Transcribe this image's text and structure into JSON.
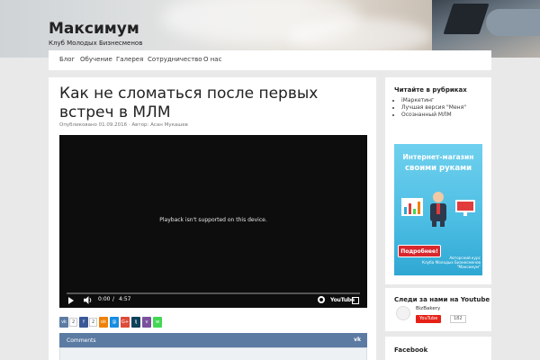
{
  "site": {
    "title": "Максимум",
    "description": "Клуб Молодых Бизнесменов"
  },
  "nav": {
    "items": [
      "Блог",
      "Обучение",
      "Галерея",
      "Сотрудничество",
      "О нас"
    ]
  },
  "post": {
    "title": "Как не сломаться после первых встреч в МЛМ",
    "meta": "Опубликовано 01.09.2016 · Автор: Асан Мукашев"
  },
  "video": {
    "message": "Playback isn't supported on this device.",
    "time_current": "0:00",
    "time_separator": "/",
    "time_total": "4:57",
    "logo": "YouTube"
  },
  "share": {
    "buttons": [
      {
        "icon": "vk-icon",
        "label": "vk",
        "count": "2",
        "color": "#5b7ba3"
      },
      {
        "icon": "facebook-icon",
        "label": "f",
        "count": "2",
        "color": "#3b5998"
      },
      {
        "icon": "odnoklassniki-icon",
        "label": "ok",
        "color": "#ee8208"
      },
      {
        "icon": "mailru-icon",
        "label": "@",
        "color": "#168de2"
      },
      {
        "icon": "googleplus-icon",
        "label": "G+",
        "color": "#dd4b39"
      },
      {
        "icon": "livejournal-icon",
        "label": "lj",
        "color": "#0d425a"
      },
      {
        "icon": "viber-icon",
        "label": "v",
        "color": "#7b519d"
      },
      {
        "icon": "whatsapp-icon",
        "label": "w",
        "color": "#43d854"
      }
    ]
  },
  "comments": {
    "label": "Comments",
    "icon": "vk-icon"
  },
  "sidebar": {
    "categories": {
      "title": "Читайте в рубриках",
      "items": [
        "iМаркетинг",
        "Лучшая версия \"Меня\"",
        "Осознанный МЛМ"
      ]
    },
    "banner": {
      "line1": "Интернет-магазин",
      "line2": "своими руками",
      "button": "Подробнее!",
      "note_line1": "Авторский курс",
      "note_line2": "Клуба Молодых Бизнесменов",
      "note_line3": "\"Максимум\""
    },
    "youtube": {
      "title": "Следи за нами на Youtube",
      "channel": "BizBakery",
      "subscribe": "YouTube",
      "count": "182"
    },
    "facebook": {
      "title": "Facebook"
    }
  }
}
